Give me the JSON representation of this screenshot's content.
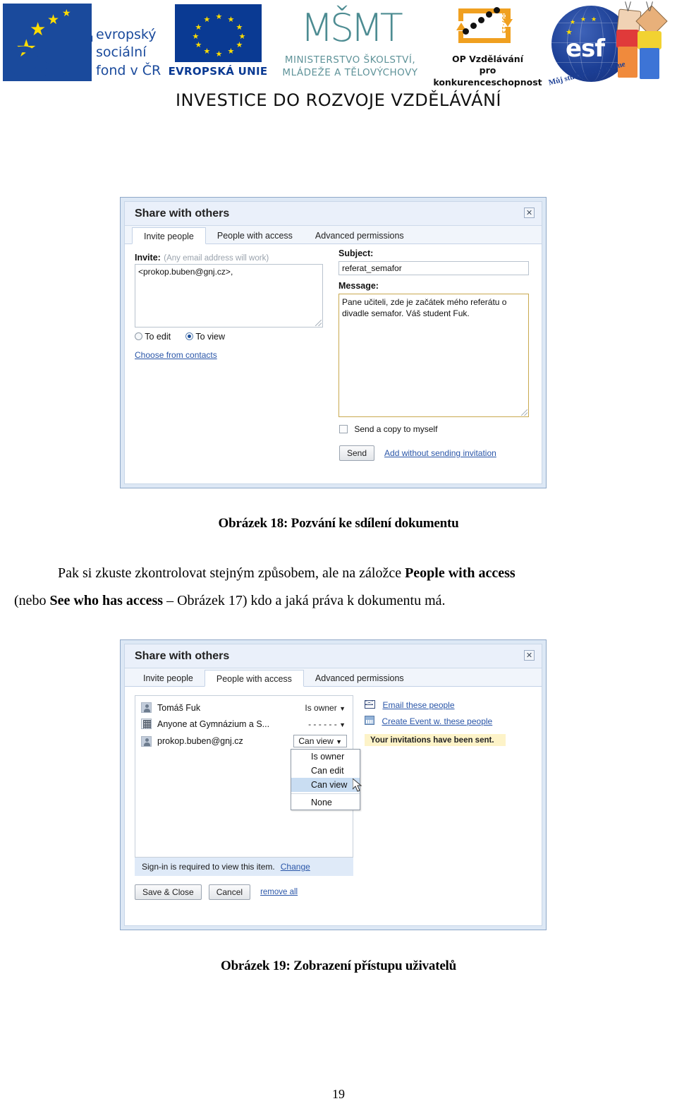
{
  "header": {
    "logos": [
      {
        "name": "esf-cr-logo",
        "lines": [
          "evropský",
          "sociální",
          "fond v ČR"
        ],
        "mark": "esf"
      },
      {
        "name": "eu-flag-logo",
        "caption": "EVROPSKÁ UNIE"
      },
      {
        "name": "msmt-logo",
        "mark": "MŠMT",
        "lines": [
          "MINISTERSTVO ŠKOLSTVÍ,",
          "MLÁDEŽE A TĚLOVÝCHOVY"
        ]
      },
      {
        "name": "op-vk-logo",
        "lines": [
          "OP Vzdělávání",
          "pro konkurenceschopnost"
        ],
        "vertical": "2007-13"
      },
      {
        "name": "esf-online-logo",
        "mark": "esf",
        "arc": "Můj studijní svět online"
      }
    ],
    "banner": "INVESTICE DO ROZVOJE  VZDĚLÁVÁNÍ"
  },
  "figure18": {
    "caption": "Obrázek 18: Pozvání ke sdílení dokumentu",
    "dialog": {
      "title": "Share with others",
      "close_icon": "close-icon",
      "tabs": [
        {
          "label": "Invite people",
          "active": true
        },
        {
          "label": "People with access",
          "active": false
        },
        {
          "label": "Advanced permissions",
          "active": false
        }
      ],
      "invite_label": "Invite:",
      "invite_hint": "(Any email address will work)",
      "invite_value": "<prokop.buben@gnj.cz>,",
      "radio_edit": "To edit",
      "radio_view": "To view",
      "radio_selected": "To view",
      "choose_contacts_link": "Choose from contacts",
      "subject_label": "Subject:",
      "subject_value": "referat_semafor",
      "message_label": "Message:",
      "message_value": "Pane učiteli, zde je začátek mého referátu o divadle semafor. Váš student Fuk.",
      "send_copy_label": "Send a copy to myself",
      "send_copy_checked": false,
      "send_button": "Send",
      "add_without_link": "Add without sending invitation"
    }
  },
  "paragraph": {
    "line1": "Pak si zkuste zkontrolovat stejným způsobem, ale na záložce ",
    "bold1": "People with access",
    "line2_a": "(nebo ",
    "bold2": "See who has access",
    "line2_b": " – Obrázek 17) kdo a jaká práva k dokumentu má."
  },
  "figure19": {
    "caption": "Obrázek 19: Zobrazení přístupu uživatelů",
    "dialog": {
      "title": "Share with others",
      "close_icon": "close-icon",
      "tabs": [
        {
          "label": "Invite people",
          "active": false
        },
        {
          "label": "People with access",
          "active": true
        },
        {
          "label": "Advanced permissions",
          "active": false
        }
      ],
      "people": [
        {
          "name": "Tomáš Fuk",
          "role": "Is owner",
          "icon": "person-icon",
          "boxed": false
        },
        {
          "name": "Anyone at Gymnázium a S...",
          "role": "- - - - - -",
          "icon": "building-icon",
          "boxed": false
        },
        {
          "name": "prokop.buben@gnj.cz",
          "role": "Can view",
          "icon": "person-icon",
          "boxed": true
        }
      ],
      "dropdown_options": [
        "Is owner",
        "Can edit",
        "Can view",
        "None"
      ],
      "dropdown_selected": "Can view",
      "actions": [
        {
          "label": "Email these people",
          "icon": "envelope-icon"
        },
        {
          "label": "Create Event w. these people",
          "icon": "calendar-icon"
        }
      ],
      "toast": "Your invitations have been sent.",
      "signin_text": "Sign-in is required to view this item.",
      "signin_link": "Change",
      "save_button": "Save & Close",
      "cancel_button": "Cancel",
      "remove_all_link": "remove all"
    }
  },
  "page_number": "19",
  "colors": {
    "dialog_chrome": "#dde8f5",
    "title_bg": "#eaf0fa",
    "link": "#2a56a8",
    "toast_bg": "#fdf3c8",
    "signin_bg": "#dfeaf8",
    "menu_selected": "#c9ddf2",
    "esf_blue": "#1a4a9c",
    "eu_blue": "#0a3a93",
    "star_yellow": "#ffdd00",
    "msmt_teal": "#4d8c92",
    "opvk_orange": "#f0a020"
  }
}
